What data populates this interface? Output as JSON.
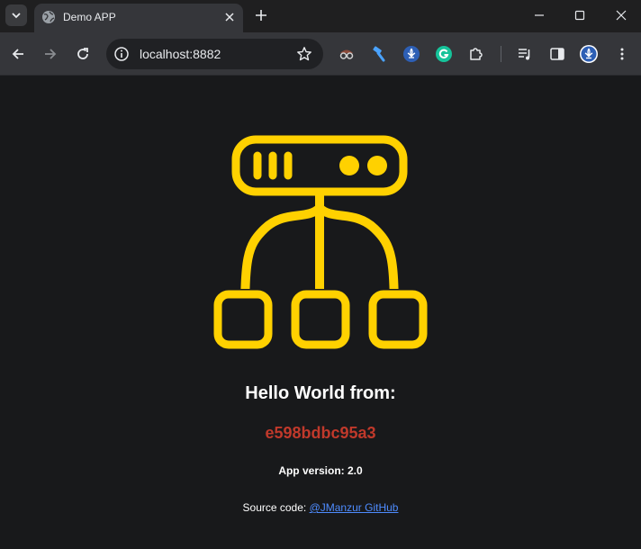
{
  "browser": {
    "tab": {
      "title": "Demo APP",
      "favicon": "globe-icon"
    },
    "url": "localhost:8882",
    "icons": {
      "tab_search": "chevron-down-icon",
      "close_tab": "close-icon",
      "new_tab": "plus-icon",
      "back": "arrow-left-icon",
      "forward": "arrow-right-icon",
      "reload": "reload-icon",
      "site_info": "info-icon",
      "bookmark": "star-icon",
      "extensions": [
        "spy-icon",
        "hammer-icon",
        "fleur-icon",
        "grammarly-icon",
        "puzzle-icon"
      ],
      "media": "media-control-icon",
      "side_panel": "side-panel-icon",
      "profile": "profile-avatar-icon",
      "menu": "kebab-menu-icon"
    }
  },
  "page": {
    "logo": "load-balancer-icon",
    "heading": "Hello World from:",
    "hostname": "e598bdbc95a3",
    "version_text": "App version: 2.0",
    "source_prefix": "Source code: ",
    "source_link": "@JManzur GitHub"
  },
  "colors": {
    "accent_yellow": "#ffd100",
    "hostname_red": "#c0392b",
    "link_blue": "#4e8cff",
    "page_bg": "#18191b"
  }
}
